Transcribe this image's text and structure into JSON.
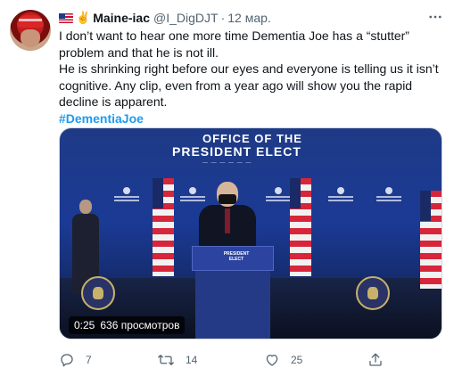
{
  "tweet": {
    "author": {
      "display_name": "Maine-iac",
      "handle": "@I_DigDJT",
      "separator": "·",
      "date": "12 мар.",
      "flag_emoji": "🇺🇸",
      "hand_emoji": "✌️"
    },
    "text": {
      "line1": "I don’t want to hear one more time Dementia Joe has a “stutter” problem and that he is not ill.",
      "line2": "He is shrinking right before our eyes and everyone is telling us it isn’t cognitive. Any clip, even from a year ago will show you the rapid decline is apparent.",
      "hashtag": "#DementiaJoe"
    },
    "media": {
      "type": "video",
      "duration": "0:25",
      "views": "636 просмотров",
      "banner": {
        "line1": "OFFICE OF THE",
        "line2": "PRESIDENT ELECT"
      },
      "podium_label": "PRESIDENT ELECT"
    },
    "actions": {
      "replies": "7",
      "retweets": "14",
      "likes": "25"
    },
    "colors": {
      "accent": "#1d9bf0",
      "secondary_text": "#536471",
      "primary_text": "#0f1419"
    },
    "icons": [
      "more-icon",
      "reply-icon",
      "retweet-icon",
      "like-icon",
      "share-icon"
    ]
  }
}
